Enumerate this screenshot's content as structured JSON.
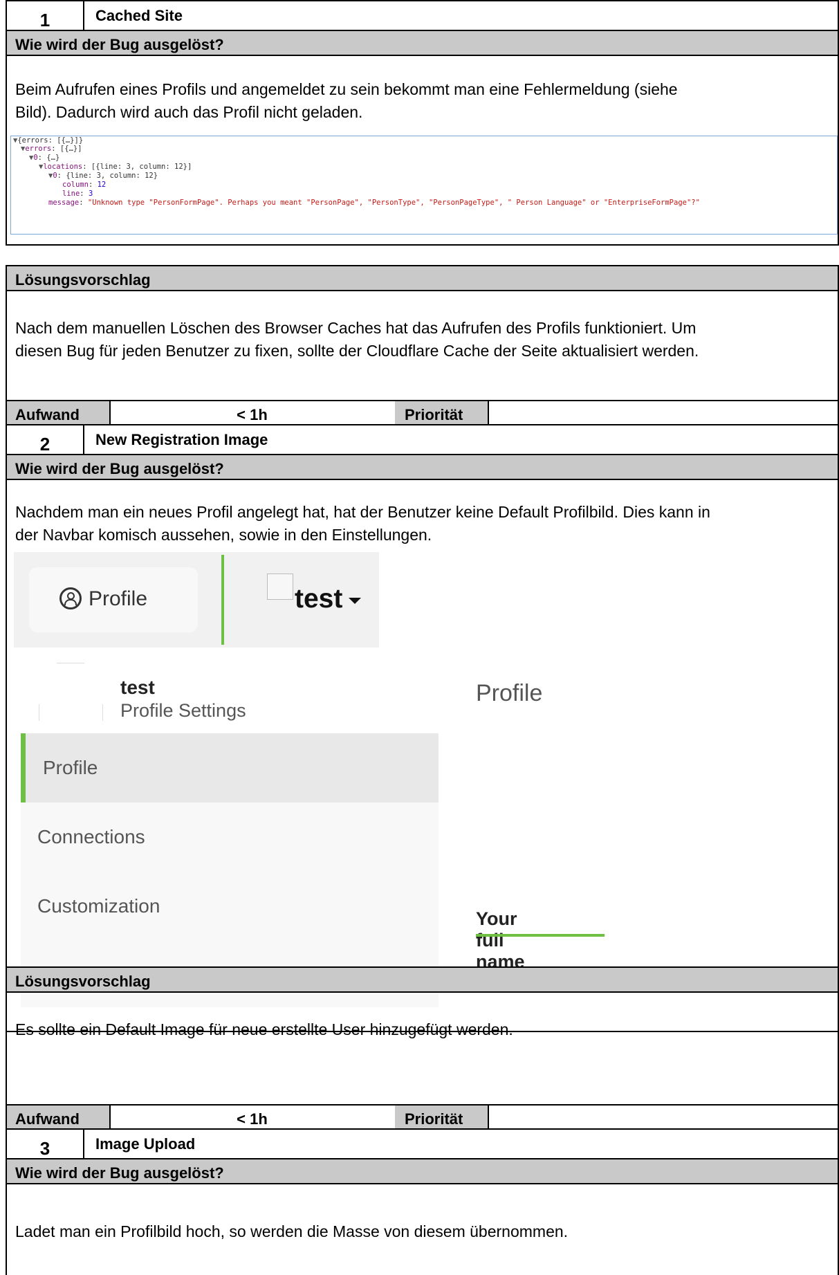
{
  "common": {
    "trigger_header": "Wie wird der Bug ausgelöst?",
    "solution_header": "Lösungsvorschlag",
    "aufwand_label": "Aufwand",
    "prioritaet_label": "Priorität"
  },
  "bugs": [
    {
      "number": "1",
      "title": "Cached Site",
      "trigger_line1": "Beim Aufrufen eines Profils und angemeldet zu sein bekommt man eine Fehlermeldung (siehe",
      "trigger_line2": "Bild). Dadurch wird auch das Profil nicht geladen.",
      "solution_line1": "Nach dem manuellen Löschen des Browser Caches hat das Aufrufen des Profils funktioniert. Um",
      "solution_line2": "diesen Bug für jeden Benutzer zu fixen, sollte der Cloudflare Cache der Seite aktualisiert werden.",
      "aufwand_value": "< 1h"
    },
    {
      "number": "2",
      "title": "New Registration Image",
      "trigger_line1": "Nachdem man ein neues Profil angelegt hat, hat der Benutzer keine Default Profilbild. Dies kann in",
      "trigger_line2": "der Navbar komisch aussehen, sowie in den Einstellungen.",
      "solution_line1": "Es sollte ein Default Image für neue erstellte User hinzugefügt werden.",
      "aufwand_value": "< 1h"
    },
    {
      "number": "3",
      "title": "Image Upload",
      "trigger_line1": "Ladet man ein Profilbild hoch, so werden die Masse von diesem übernommen."
    }
  ],
  "code_screenshot": {
    "line1": "{errors: [{…}]}",
    "line2_key": "errors",
    "line2_val": "[{…}]",
    "line3_key": "0",
    "line3_val": "{…}",
    "line4_key": "locations",
    "line4_val": "[{line: 3, column: 12}]",
    "line5_key": "0",
    "line5_val": "{line: 3, column: 12}",
    "line6_key": "column",
    "line6_val": "12",
    "line7_key": "line",
    "line7_val": "3",
    "line8_key": "message",
    "line8_val": "\"Unknown type \"PersonFormPage\". Perhaps you meant \"PersonPage\", \"PersonType\", \"PersonPageType\", \" Person Language\" or \"EnterpriseFormPage\"?\""
  },
  "profile_screenshot": {
    "nav_profile_label": "Profile",
    "nav_username": "test",
    "user_name": "test",
    "user_subtitle": "Profile Settings",
    "section_title": "Profile",
    "menu_items": [
      "Profile",
      "Connections",
      "Customization"
    ],
    "field_label": "Your full name",
    "accent_color": "#6ec045"
  }
}
